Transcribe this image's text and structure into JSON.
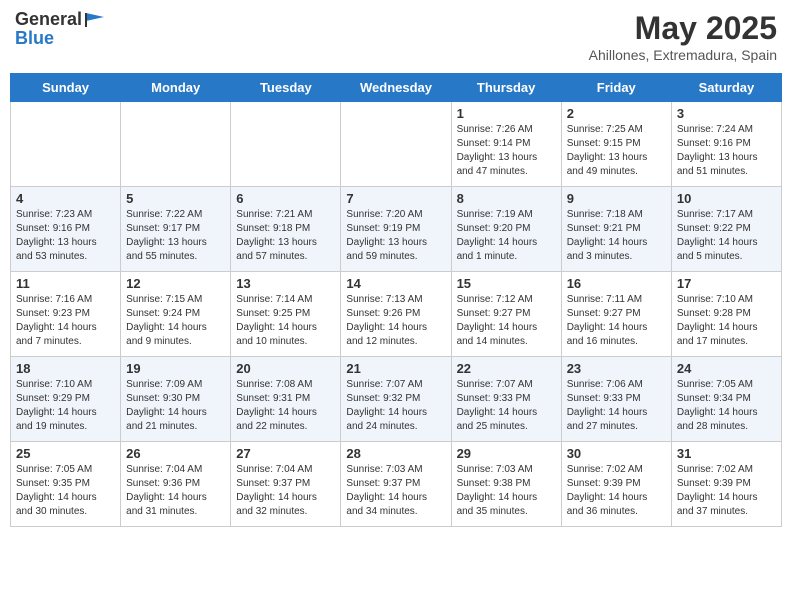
{
  "header": {
    "logo_general": "General",
    "logo_blue": "Blue",
    "title": "May 2025",
    "subtitle": "Ahillones, Extremadura, Spain"
  },
  "days_of_week": [
    "Sunday",
    "Monday",
    "Tuesday",
    "Wednesday",
    "Thursday",
    "Friday",
    "Saturday"
  ],
  "weeks": [
    [
      {
        "day": "",
        "info": ""
      },
      {
        "day": "",
        "info": ""
      },
      {
        "day": "",
        "info": ""
      },
      {
        "day": "",
        "info": ""
      },
      {
        "day": "1",
        "info": "Sunrise: 7:26 AM\nSunset: 9:14 PM\nDaylight: 13 hours\nand 47 minutes."
      },
      {
        "day": "2",
        "info": "Sunrise: 7:25 AM\nSunset: 9:15 PM\nDaylight: 13 hours\nand 49 minutes."
      },
      {
        "day": "3",
        "info": "Sunrise: 7:24 AM\nSunset: 9:16 PM\nDaylight: 13 hours\nand 51 minutes."
      }
    ],
    [
      {
        "day": "4",
        "info": "Sunrise: 7:23 AM\nSunset: 9:16 PM\nDaylight: 13 hours\nand 53 minutes."
      },
      {
        "day": "5",
        "info": "Sunrise: 7:22 AM\nSunset: 9:17 PM\nDaylight: 13 hours\nand 55 minutes."
      },
      {
        "day": "6",
        "info": "Sunrise: 7:21 AM\nSunset: 9:18 PM\nDaylight: 13 hours\nand 57 minutes."
      },
      {
        "day": "7",
        "info": "Sunrise: 7:20 AM\nSunset: 9:19 PM\nDaylight: 13 hours\nand 59 minutes."
      },
      {
        "day": "8",
        "info": "Sunrise: 7:19 AM\nSunset: 9:20 PM\nDaylight: 14 hours\nand 1 minute."
      },
      {
        "day": "9",
        "info": "Sunrise: 7:18 AM\nSunset: 9:21 PM\nDaylight: 14 hours\nand 3 minutes."
      },
      {
        "day": "10",
        "info": "Sunrise: 7:17 AM\nSunset: 9:22 PM\nDaylight: 14 hours\nand 5 minutes."
      }
    ],
    [
      {
        "day": "11",
        "info": "Sunrise: 7:16 AM\nSunset: 9:23 PM\nDaylight: 14 hours\nand 7 minutes."
      },
      {
        "day": "12",
        "info": "Sunrise: 7:15 AM\nSunset: 9:24 PM\nDaylight: 14 hours\nand 9 minutes."
      },
      {
        "day": "13",
        "info": "Sunrise: 7:14 AM\nSunset: 9:25 PM\nDaylight: 14 hours\nand 10 minutes."
      },
      {
        "day": "14",
        "info": "Sunrise: 7:13 AM\nSunset: 9:26 PM\nDaylight: 14 hours\nand 12 minutes."
      },
      {
        "day": "15",
        "info": "Sunrise: 7:12 AM\nSunset: 9:27 PM\nDaylight: 14 hours\nand 14 minutes."
      },
      {
        "day": "16",
        "info": "Sunrise: 7:11 AM\nSunset: 9:27 PM\nDaylight: 14 hours\nand 16 minutes."
      },
      {
        "day": "17",
        "info": "Sunrise: 7:10 AM\nSunset: 9:28 PM\nDaylight: 14 hours\nand 17 minutes."
      }
    ],
    [
      {
        "day": "18",
        "info": "Sunrise: 7:10 AM\nSunset: 9:29 PM\nDaylight: 14 hours\nand 19 minutes."
      },
      {
        "day": "19",
        "info": "Sunrise: 7:09 AM\nSunset: 9:30 PM\nDaylight: 14 hours\nand 21 minutes."
      },
      {
        "day": "20",
        "info": "Sunrise: 7:08 AM\nSunset: 9:31 PM\nDaylight: 14 hours\nand 22 minutes."
      },
      {
        "day": "21",
        "info": "Sunrise: 7:07 AM\nSunset: 9:32 PM\nDaylight: 14 hours\nand 24 minutes."
      },
      {
        "day": "22",
        "info": "Sunrise: 7:07 AM\nSunset: 9:33 PM\nDaylight: 14 hours\nand 25 minutes."
      },
      {
        "day": "23",
        "info": "Sunrise: 7:06 AM\nSunset: 9:33 PM\nDaylight: 14 hours\nand 27 minutes."
      },
      {
        "day": "24",
        "info": "Sunrise: 7:05 AM\nSunset: 9:34 PM\nDaylight: 14 hours\nand 28 minutes."
      }
    ],
    [
      {
        "day": "25",
        "info": "Sunrise: 7:05 AM\nSunset: 9:35 PM\nDaylight: 14 hours\nand 30 minutes."
      },
      {
        "day": "26",
        "info": "Sunrise: 7:04 AM\nSunset: 9:36 PM\nDaylight: 14 hours\nand 31 minutes."
      },
      {
        "day": "27",
        "info": "Sunrise: 7:04 AM\nSunset: 9:37 PM\nDaylight: 14 hours\nand 32 minutes."
      },
      {
        "day": "28",
        "info": "Sunrise: 7:03 AM\nSunset: 9:37 PM\nDaylight: 14 hours\nand 34 minutes."
      },
      {
        "day": "29",
        "info": "Sunrise: 7:03 AM\nSunset: 9:38 PM\nDaylight: 14 hours\nand 35 minutes."
      },
      {
        "day": "30",
        "info": "Sunrise: 7:02 AM\nSunset: 9:39 PM\nDaylight: 14 hours\nand 36 minutes."
      },
      {
        "day": "31",
        "info": "Sunrise: 7:02 AM\nSunset: 9:39 PM\nDaylight: 14 hours\nand 37 minutes."
      }
    ]
  ]
}
